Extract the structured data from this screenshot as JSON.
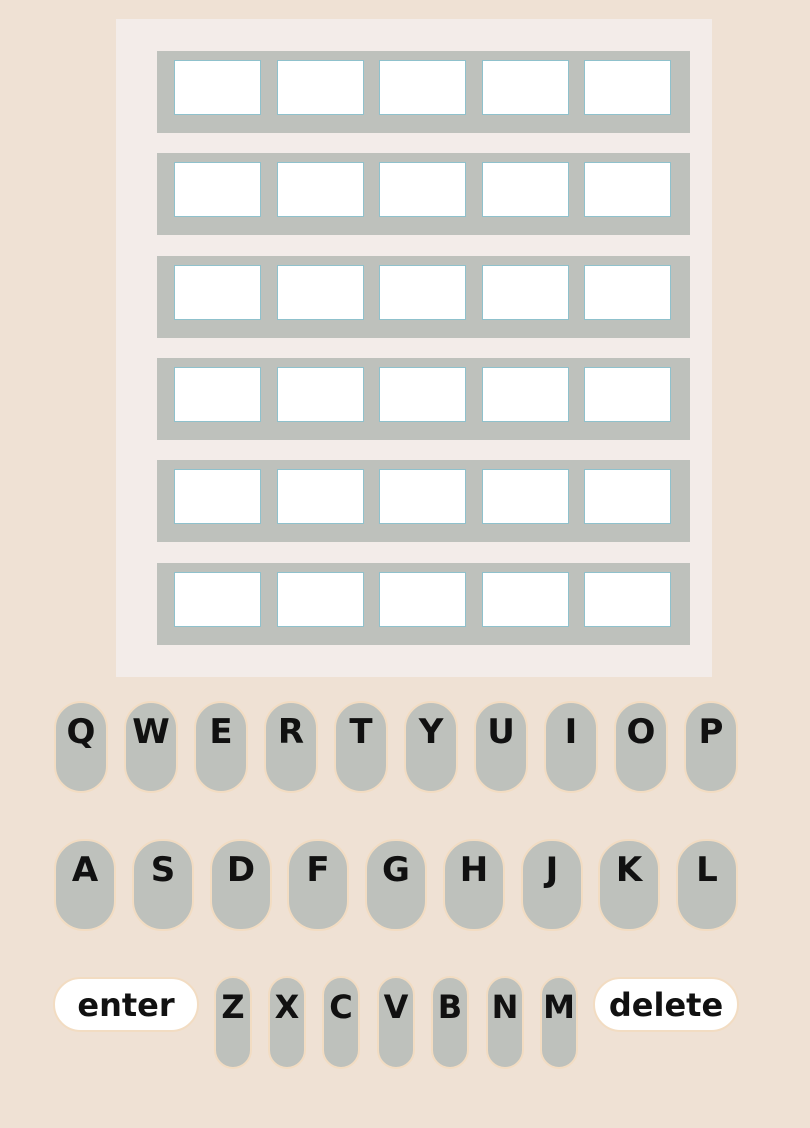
{
  "keyboard": {
    "row1": [
      "Q",
      "W",
      "E",
      "R",
      "T",
      "Y",
      "U",
      "I",
      "O",
      "P"
    ],
    "row2": [
      "A",
      "S",
      "D",
      "F",
      "G",
      "H",
      "J",
      "K",
      "L"
    ],
    "row3": [
      "Z",
      "X",
      "C",
      "V",
      "B",
      "N",
      "M"
    ],
    "enter_label": "enter",
    "delete_label": "delete"
  },
  "colors": {
    "background": "#efe1d4",
    "board": "#f3ece9",
    "row": "#bec1bc",
    "tile": "#ffffff",
    "tile_border": "#8fc1cc",
    "key": "#bec1bc"
  }
}
